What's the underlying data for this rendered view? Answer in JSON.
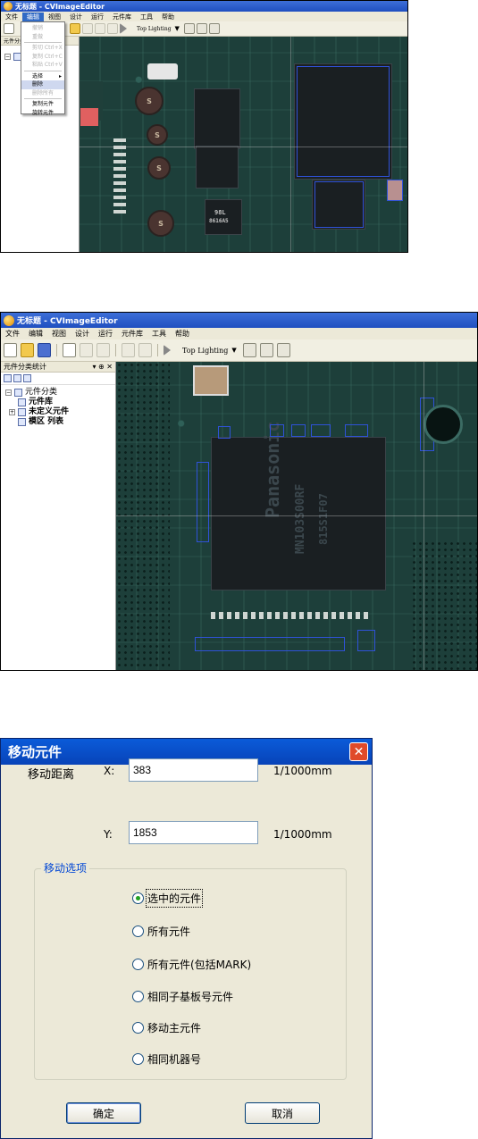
{
  "screen1": {
    "title": "无标题 - CVImageEditor",
    "menu": [
      "文件",
      "编辑",
      "视图",
      "设计",
      "运行",
      "元件库",
      "工具",
      "帮助"
    ],
    "lighting": "Top Lighting",
    "side_header": "元件分类",
    "edit_menu_items": [
      {
        "label": "撤销",
        "state": "disabled"
      },
      {
        "label": "重做",
        "state": "disabled"
      },
      {
        "label": "剪切 Ctrl+X",
        "state": "disabled"
      },
      {
        "label": "复制 Ctrl+C",
        "state": "disabled"
      },
      {
        "label": "粘贴 Ctrl+V",
        "state": "disabled"
      },
      {
        "label": "选择",
        "state": "submenu"
      },
      {
        "label": "删除",
        "state": "highlighted"
      },
      {
        "label": "删除所有",
        "state": "disabled"
      },
      {
        "label": "复制元件",
        "state": "normal"
      },
      {
        "label": "旋转元件",
        "state": "normal"
      }
    ],
    "chip_markings": [
      "98L",
      "8616A5"
    ],
    "cap_markings": [
      "S",
      "S",
      "S",
      "S"
    ]
  },
  "screen2": {
    "title": "无标题 - CVImageEditor",
    "menu": [
      "文件",
      "编辑",
      "视图",
      "设计",
      "运行",
      "元件库",
      "工具",
      "帮助"
    ],
    "lighting": "Top Lighting",
    "side_panel_title": "元件分类统计",
    "panel_controls": "▾ ⊕ ✕",
    "tree": {
      "root": "元件分类",
      "items": [
        "元件库",
        "未定义元件",
        "模区 列表"
      ]
    },
    "chip_marking": [
      "Panasonic",
      "MN103S00RF",
      "815S1F07"
    ]
  },
  "dialog": {
    "title": "移动元件",
    "distance_label": "移动距离",
    "x_label": "X:",
    "x_value": "383",
    "y_label": "Y:",
    "y_value": "1853",
    "unit": "1/1000mm",
    "options_legend": "移动选项",
    "options": [
      "选中的元件",
      "所有元件",
      "所有元件(包括MARK)",
      "相同子基板号元件",
      "移动主元件",
      "相同机器号"
    ],
    "selected_option": 0,
    "ok_label": "确定",
    "cancel_label": "取消"
  },
  "colors": {
    "title_blue": "#0843b8",
    "pcb_green": "#1d3f3a",
    "component_outline": "#2f52d8",
    "radio_green": "#21a121",
    "close_red": "#e04a2a"
  }
}
